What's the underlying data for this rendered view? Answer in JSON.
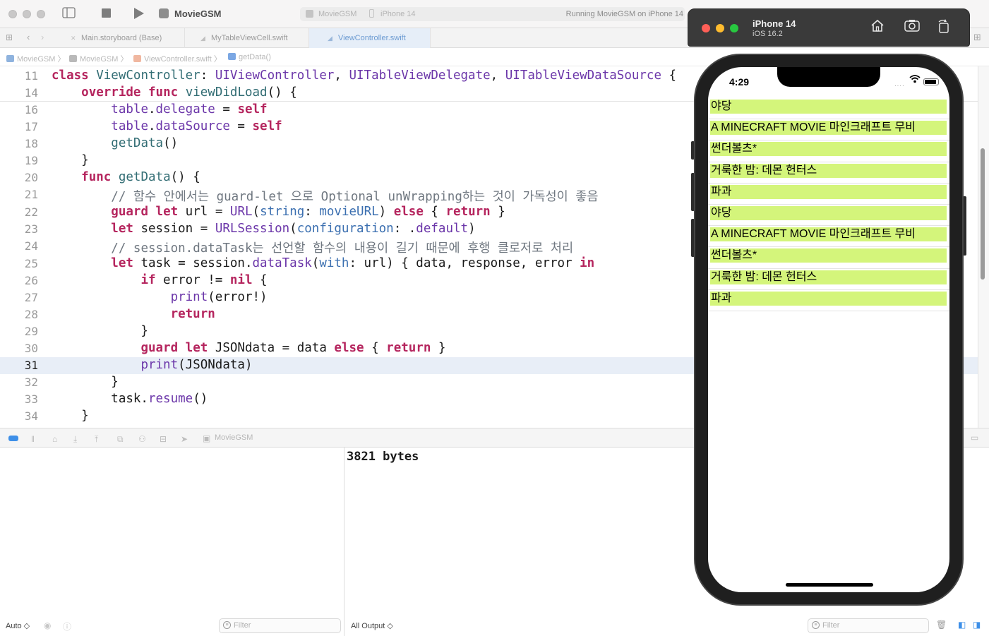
{
  "toolbar": {
    "app_name": "MovieGSM",
    "scheme_target": "MovieGSM",
    "scheme_device": "iPhone 14",
    "status": "Running MovieGSM on iPhone 14",
    "icons": [
      "sidebar-toggle-icon",
      "stop-icon",
      "run-icon"
    ]
  },
  "tabs": [
    {
      "label": "Main.storyboard (Base)",
      "icon": "storyboard-icon"
    },
    {
      "label": "MyTableViewCell.swift",
      "icon": "swift-file-icon"
    },
    {
      "label": "ViewController.swift",
      "icon": "swift-file-icon",
      "active": true
    }
  ],
  "breadcrumb": [
    "MovieGSM",
    "MovieGSM",
    "ViewController.swift",
    "getData()"
  ],
  "code": {
    "current_line": 31,
    "lines": [
      {
        "n": "11",
        "text": "class ViewController: UIViewController, UITableViewDelegate, UITableViewDataSource {"
      },
      {
        "n": "14",
        "text": "    override func viewDidLoad() {"
      },
      {
        "n": "16",
        "text": "        table.delegate = self"
      },
      {
        "n": "17",
        "text": "        table.dataSource = self"
      },
      {
        "n": "18",
        "text": "        getData()"
      },
      {
        "n": "19",
        "text": "    }"
      },
      {
        "n": "20",
        "text": "    func getData() {"
      },
      {
        "n": "21",
        "text": "        // 함수 안에서는 guard-let 으로 Optional unWrapping하는 것이 가독성이 좋음"
      },
      {
        "n": "22",
        "text": "        guard let url = URL(string: movieURL) else { return }"
      },
      {
        "n": "23",
        "text": "        let session = URLSession(configuration: .default)"
      },
      {
        "n": "24",
        "text": "        // session.dataTask는 선언할 함수의 내용이 길기 때문에 후행 클로저로 처리"
      },
      {
        "n": "25",
        "text": "        let task = session.dataTask(with: url) { data, response, error in"
      },
      {
        "n": "26",
        "text": "            if error != nil {"
      },
      {
        "n": "27",
        "text": "                print(error!)"
      },
      {
        "n": "28",
        "text": "                return"
      },
      {
        "n": "29",
        "text": "            }"
      },
      {
        "n": "30",
        "text": "            guard let JSONdata = data else { return }"
      },
      {
        "n": "31",
        "text": "            print(JSONdata)"
      },
      {
        "n": "32",
        "text": "        }"
      },
      {
        "n": "33",
        "text": "        task.resume()"
      },
      {
        "n": "34",
        "text": "    }"
      }
    ]
  },
  "debug_bar": {
    "target": "MovieGSM"
  },
  "console": {
    "output": "3821 bytes"
  },
  "footer": {
    "vars_mode": "Auto ◇",
    "output_mode": "All Output ◇",
    "filter_placeholder": "Filter"
  },
  "simulator": {
    "title": "iPhone 14",
    "subtitle": "iOS 16.2",
    "time": "4:29",
    "rows": [
      "야당",
      "A MINECRAFT MOVIE 마인크래프트 무비",
      "썬더볼츠*",
      "거룩한 밤: 데몬 헌터스",
      "파과",
      "야당",
      "A MINECRAFT MOVIE 마인크래프트 무비",
      "썬더볼츠*",
      "거룩한 밤: 데몬 헌터스",
      "파과"
    ],
    "row_color": "#d4f57b"
  }
}
